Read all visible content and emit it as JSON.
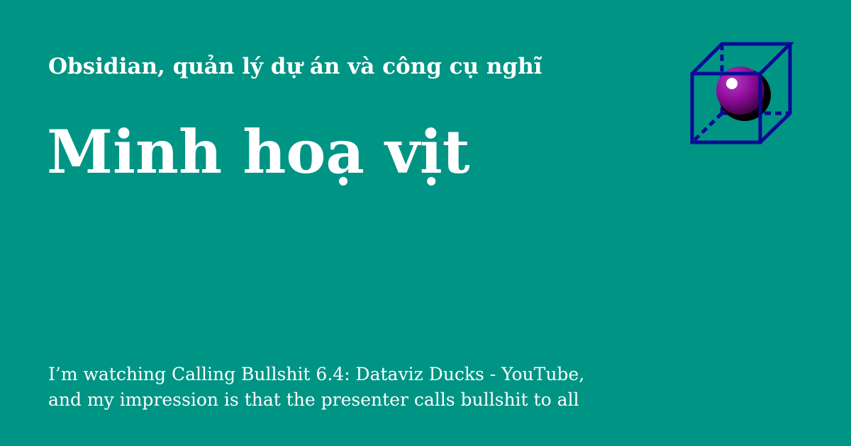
{
  "site": {
    "name": "Obsidian, quản lý dự án và công cụ nghĩ"
  },
  "post": {
    "title": "Minh hoạ vịt",
    "excerpt_lines": [
      "I’m watching Calling Bullshit 6.4: Dataviz Ducks - YouTube,",
      "and my impression is that the presenter calls bullshit to all"
    ]
  },
  "logo": {
    "icon": "cube-with-sphere-icon",
    "cube_color": "#0a0a96",
    "sphere_color": "#8b0a96"
  },
  "colors": {
    "background": "#009485",
    "text": "#ffffff"
  }
}
